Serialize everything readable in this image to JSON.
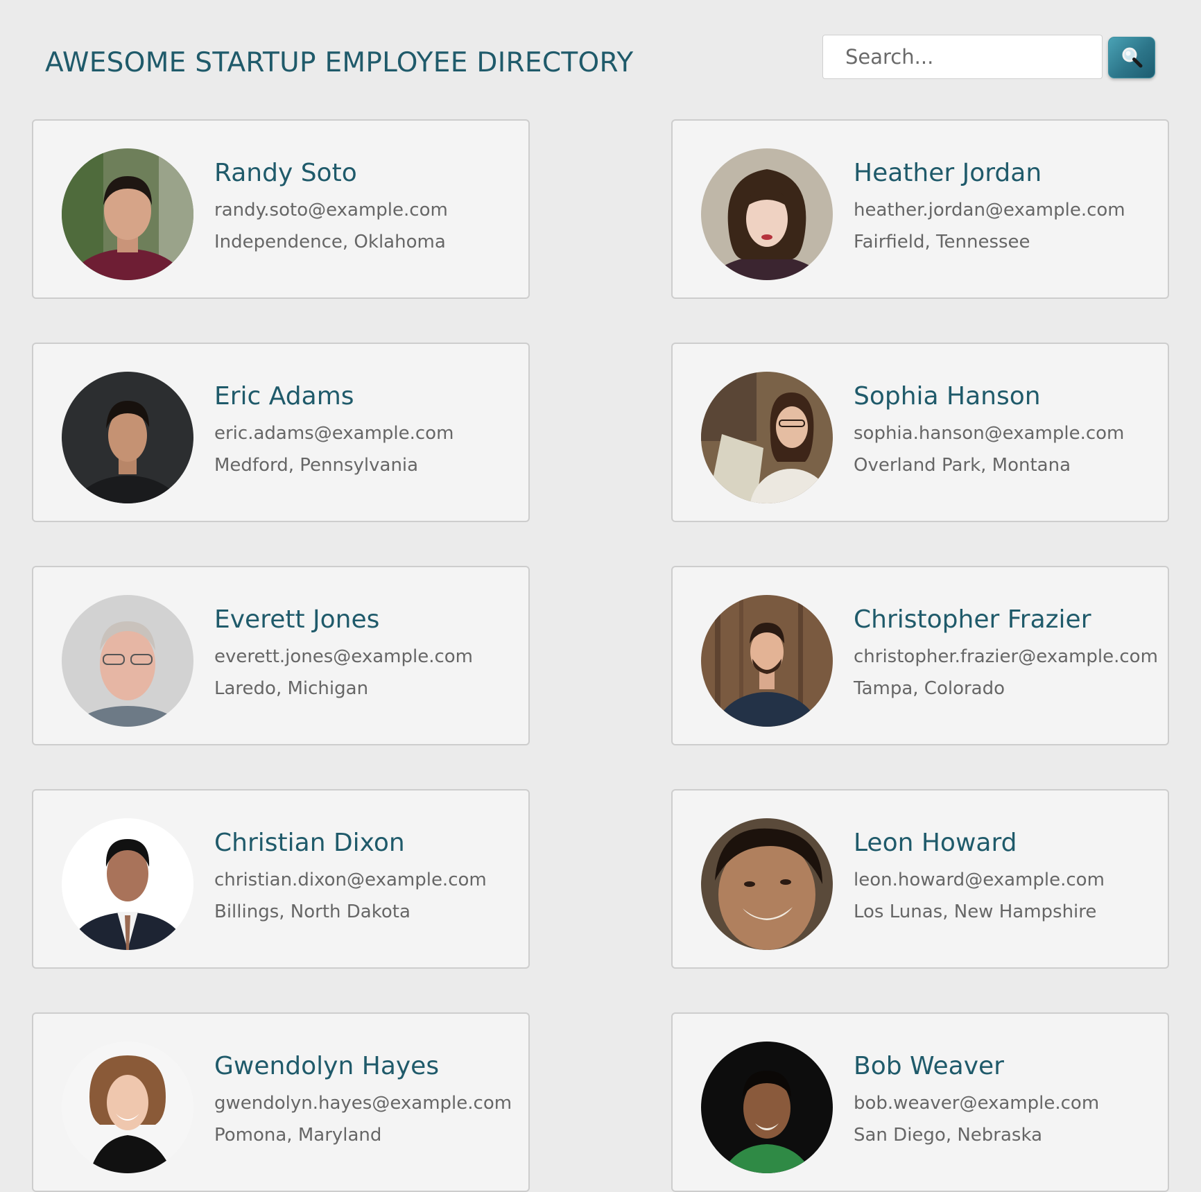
{
  "header": {
    "title": "AWESOME STARTUP EMPLOYEE DIRECTORY",
    "search_placeholder": "Search...",
    "search_icon": "magnifier-icon"
  },
  "employees": [
    {
      "name": "Randy Soto",
      "email": "randy.soto@example.com",
      "location": "Independence, Oklahoma"
    },
    {
      "name": "Heather Jordan",
      "email": "heather.jordan@example.com",
      "location": "Fairfield, Tennessee"
    },
    {
      "name": "Eric Adams",
      "email": "eric.adams@example.com",
      "location": "Medford, Pennsylvania"
    },
    {
      "name": "Sophia Hanson",
      "email": "sophia.hanson@example.com",
      "location": "Overland Park, Montana"
    },
    {
      "name": "Everett Jones",
      "email": "everett.jones@example.com",
      "location": "Laredo, Michigan"
    },
    {
      "name": "Christopher Frazier",
      "email": "christopher.frazier@example.com",
      "location": "Tampa, Colorado"
    },
    {
      "name": "Christian Dixon",
      "email": "christian.dixon@example.com",
      "location": "Billings, North Dakota"
    },
    {
      "name": "Leon Howard",
      "email": "leon.howard@example.com",
      "location": "Los Lunas, New Hampshire"
    },
    {
      "name": "Gwendolyn Hayes",
      "email": "gwendolyn.hayes@example.com",
      "location": "Pomona, Maryland"
    },
    {
      "name": "Bob Weaver",
      "email": "bob.weaver@example.com",
      "location": "San Diego, Nebraska"
    }
  ],
  "colors": {
    "accent": "#1f5a6a",
    "background": "#ebebeb",
    "card": "#f4f4f4",
    "search_button": "#2c7589"
  }
}
